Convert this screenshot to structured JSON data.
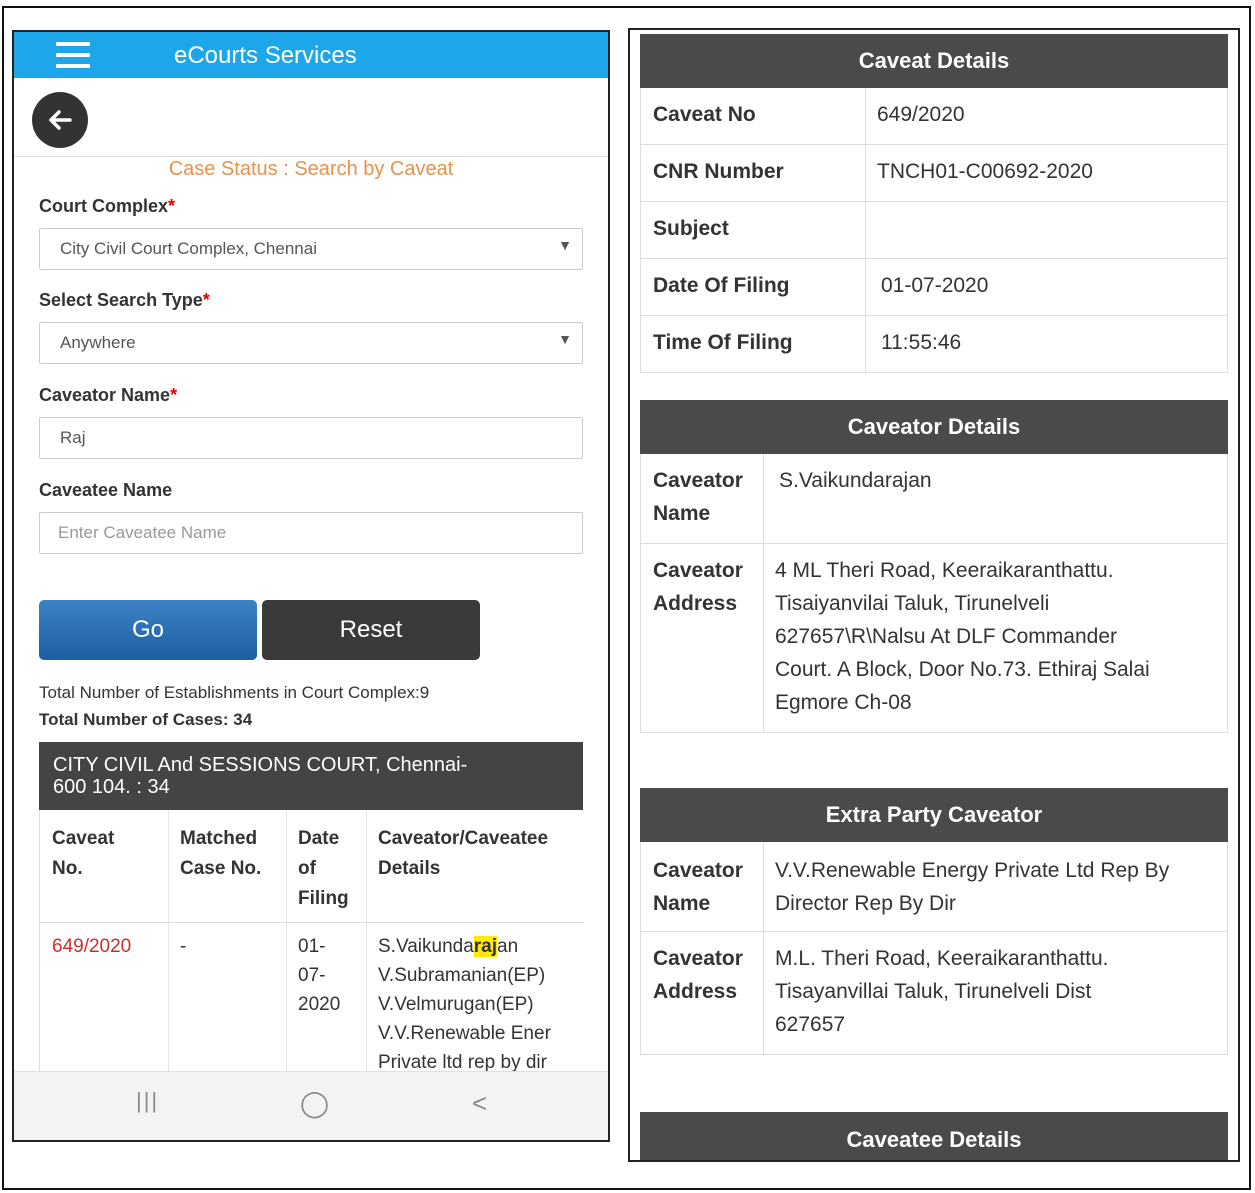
{
  "phone": {
    "app_title": "eCourts Services",
    "page_heading": "Case Status : Search by Caveat",
    "court_complex_label": "Court Complex",
    "court_complex_value": "City Civil Court Complex, Chennai",
    "search_type_label": "Select Search Type",
    "search_type_value": "Anywhere",
    "caveator_name_label": "Caveator Name",
    "caveator_name_value": "Raj",
    "caveatee_name_label": "Caveatee Name",
    "caveatee_name_placeholder": "Enter Caveatee Name",
    "required_mark": "*",
    "go_label": "Go",
    "reset_label": "Reset",
    "total_establishments": "Total Number of Establishments in Court Complex:9",
    "total_cases": "Total Number of Cases: 34",
    "court_header_line1": "CITY CIVIL And SESSIONS COURT, Chennai-",
    "court_header_line2": "600 104. : 34",
    "table": {
      "headers": [
        "Caveat No.",
        "Matched Case No.",
        "Date of Filing",
        "Caveator/Caveatee Details"
      ],
      "header_lines": [
        [
          "Caveat",
          "No."
        ],
        [
          "Matched",
          "Case No."
        ],
        [
          "Date",
          "of",
          "Filing"
        ],
        [
          "Caveator/Caveatee",
          "Details"
        ]
      ],
      "row": {
        "caveat_no": "649/2020",
        "matched_case": "-",
        "date_lines": [
          "01-",
          "07-",
          "2020"
        ],
        "details_first_pre": "S.Vaikunda",
        "details_first_hl": "raj",
        "details_first_post": "an",
        "details_lines": [
          "V.Subramanian(EP)",
          "V.Velmurugan(EP)",
          "V.V.Renewable Ener",
          "Private ltd rep by dir"
        ]
      }
    },
    "nav": {
      "recent": "|||",
      "home": "◯",
      "back": "<"
    }
  },
  "right": {
    "caveat_details_title": "Caveat Details",
    "caveat_rows": [
      {
        "key": "Caveat No",
        "value": "649/2020"
      },
      {
        "key": "CNR Number",
        "value": "TNCH01-C00692-2020"
      },
      {
        "key": "Subject",
        "value": ""
      },
      {
        "key": "Date Of Filing",
        "value": "01-07-2020"
      },
      {
        "key": "Time Of Filing",
        "value": "11:55:46"
      }
    ],
    "caveator_details_title": "Caveator Details",
    "caveator_name_key": [
      "Caveator",
      "Name"
    ],
    "caveator_name_value": "S.Vaikundarajan",
    "caveator_address_key": [
      "Caveator",
      "Address"
    ],
    "caveator_address_lines": [
      "4 ML Theri Road, Keeraikaranthattu.",
      "Tisaiyanvilai Taluk, Tirunelveli",
      "627657\\R\\Nalsu At DLF Commander",
      "Court. A Block, Door No.73. Ethiraj Salai",
      "Egmore Ch-08"
    ],
    "extra_party_title": "Extra Party Caveator",
    "extra_name_key": [
      "Caveator",
      "Name"
    ],
    "extra_name_lines": [
      "V.V.Renewable Energy Private Ltd Rep By",
      "Director Rep By Dir"
    ],
    "extra_address_key": [
      "Caveator",
      "Address"
    ],
    "extra_address_lines": [
      "M.L. Theri Road, Keeraikaranthattu.",
      "Tisayanvillai Taluk, Tirunelveli Dist",
      "627657"
    ],
    "caveatee_details_title": "Caveatee Details"
  }
}
